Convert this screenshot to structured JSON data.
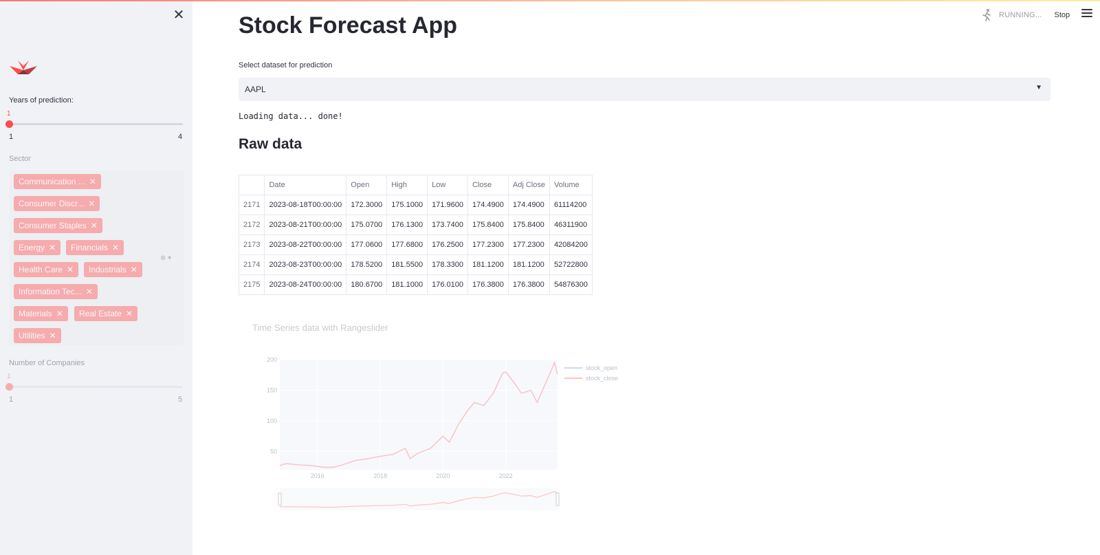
{
  "sidebar": {
    "years_label": "Years of prediction:",
    "years_value": "1",
    "years_min": "1",
    "years_max": "4",
    "years_fraction": 0,
    "sector_label": "Sector",
    "sectors": [
      "Communication ...",
      "Consumer Discr...",
      "Consumer Staples",
      "Energy",
      "Financials",
      "Health Care",
      "Industrials",
      "Information Tec...",
      "Materials",
      "Real Estate",
      "Utilities"
    ],
    "chip_remove_glyph": "✕",
    "companies_label": "Number of Companies",
    "companies_value": "1",
    "companies_min": "1",
    "companies_max": "5",
    "companies_fraction": 0
  },
  "header": {
    "title": "Stock Forecast App",
    "status": "RUNNING...",
    "stop_label": "Stop"
  },
  "main": {
    "select_label": "Select dataset for prediction",
    "select_value": "AAPL",
    "loading_text": "Loading data... done!",
    "raw_title": "Raw data"
  },
  "table": {
    "columns": [
      "",
      "Date",
      "Open",
      "High",
      "Low",
      "Close",
      "Adj Close",
      "Volume"
    ],
    "rows": [
      [
        "2171",
        "2023-08-18T00:00:00",
        "172.3000",
        "175.1000",
        "171.9600",
        "174.4900",
        "174.4900",
        "61114200"
      ],
      [
        "2172",
        "2023-08-21T00:00:00",
        "175.0700",
        "176.1300",
        "173.7400",
        "175.8400",
        "175.8400",
        "46311900"
      ],
      [
        "2173",
        "2023-08-22T00:00:00",
        "177.0600",
        "177.6800",
        "176.2500",
        "177.2300",
        "177.2300",
        "42084200"
      ],
      [
        "2174",
        "2023-08-23T00:00:00",
        "178.5200",
        "181.5500",
        "178.3300",
        "181.1200",
        "181.1200",
        "52722800"
      ],
      [
        "2175",
        "2023-08-24T00:00:00",
        "180.6700",
        "181.1000",
        "176.0100",
        "176.3800",
        "176.3800",
        "54876300"
      ]
    ]
  },
  "colors": {
    "accent": "#ff4b4b",
    "open_line": "#6b8fd6",
    "close_line": "#ff4b4b"
  },
  "chart_data": {
    "type": "line",
    "title": "Time Series data with Rangeslider",
    "xlabel": "",
    "ylabel": "",
    "x_ticks": [
      "2016",
      "2018",
      "2020",
      "2022"
    ],
    "y_ticks": [
      50,
      100,
      150,
      200
    ],
    "ylim": [
      20,
      200
    ],
    "xlim": [
      2014.8,
      2023.65
    ],
    "grid": true,
    "legend": "top-right",
    "rangeslider": true,
    "x": [
      2014.8,
      2015.0,
      2015.4,
      2015.8,
      2016.2,
      2016.5,
      2016.8,
      2017.2,
      2017.6,
      2018.0,
      2018.4,
      2018.8,
      2018.95,
      2019.2,
      2019.6,
      2020.0,
      2020.2,
      2020.5,
      2020.8,
      2021.0,
      2021.3,
      2021.6,
      2021.9,
      2022.0,
      2022.3,
      2022.5,
      2022.8,
      2023.0,
      2023.3,
      2023.55,
      2023.65
    ],
    "series": [
      {
        "name": "stock_open",
        "values": [
          27,
          30,
          28,
          27,
          24,
          24,
          28,
          35,
          38,
          42,
          45,
          55,
          38,
          47,
          55,
          75,
          65,
          95,
          118,
          130,
          125,
          145,
          178,
          180,
          160,
          145,
          150,
          130,
          165,
          195,
          177
        ]
      },
      {
        "name": "stock_close",
        "values": [
          27,
          30,
          28,
          27,
          24,
          24,
          28,
          35,
          38,
          42,
          45,
          55,
          38,
          47,
          55,
          75,
          65,
          95,
          118,
          130,
          125,
          145,
          178,
          180,
          160,
          145,
          150,
          130,
          165,
          195,
          176
        ]
      }
    ]
  }
}
